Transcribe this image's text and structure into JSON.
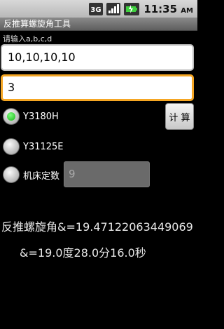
{
  "status_bar": {
    "network_badge": "3G",
    "signal_icon": "signal-bars-icon",
    "battery_icon": "battery-icon",
    "time": "11:35",
    "ampm": "AM"
  },
  "app": {
    "title": "反推算螺旋角工具"
  },
  "form": {
    "hint": "请输入a,b,c,d",
    "abcd_value": "10,10,10,10",
    "second_value": "3",
    "options": [
      {
        "label": "Y3180H",
        "selected": true
      },
      {
        "label": "Y31125E",
        "selected": false
      },
      {
        "label": "机床定数",
        "selected": false
      }
    ],
    "machine_constant_value": "9",
    "calc_button": "计 算"
  },
  "result": {
    "line1": "反推螺旋角&=19.47122063449069",
    "line2": "&=19.0度28.0分16.0秒"
  }
}
